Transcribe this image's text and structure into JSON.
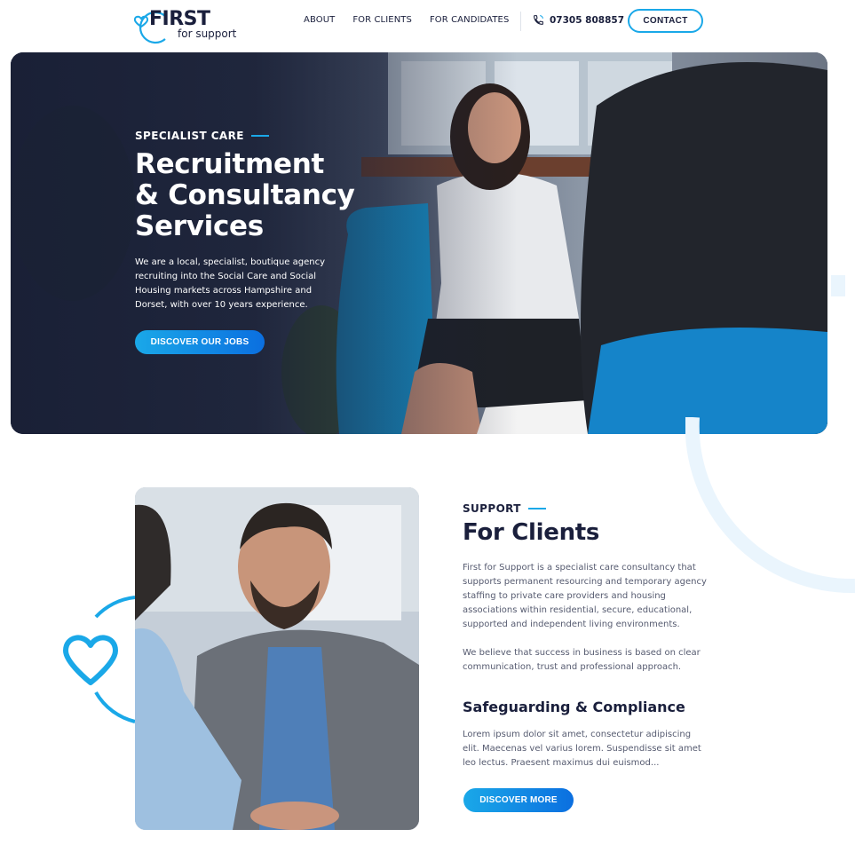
{
  "header": {
    "logo": {
      "name": "FIRST",
      "tagline": "for support"
    },
    "nav": [
      {
        "label": "ABOUT"
      },
      {
        "label": "FOR CLIENTS"
      },
      {
        "label": "FOR CANDIDATES"
      }
    ],
    "phone": {
      "icon": "phone-icon",
      "number": "07305 808857"
    },
    "contact_label": "CONTACT"
  },
  "hero": {
    "eyebrow": "SPECIALIST CARE",
    "title_lines": [
      "Recruitment",
      "& Consultancy",
      "Services"
    ],
    "description": "We are a local, specialist, boutique agency recruiting into the Social Care and Social Housing markets across Hampshire and Dorset, with over 10 years experience.",
    "cta_label": "DISCOVER OUR JOBS"
  },
  "clients": {
    "eyebrow": "SUPPORT",
    "title": "For Clients",
    "paragraph_1": "First for Support is a specialist care consultancy that supports permanent resourcing and temporary agency staffing to private care providers and housing associations within residential, secure, educational, supported and independent living environments.",
    "paragraph_2": "We believe that success in business is based on clear communication, trust and professional approach.",
    "subheading": "Safeguarding & Compliance",
    "paragraph_3": "Lorem ipsum dolor sit amet, consectetur adipiscing elit. Maecenas vel varius lorem. Suspendisse sit amet leo lectus. Praesent maximus dui euismod...",
    "cta_label": "DISCOVER MORE"
  },
  "colors": {
    "brand_blue": "#1aa8e8",
    "brand_blue_dark": "#0b6fe0",
    "navy": "#1a1f3c",
    "text_grey": "#565b70"
  }
}
